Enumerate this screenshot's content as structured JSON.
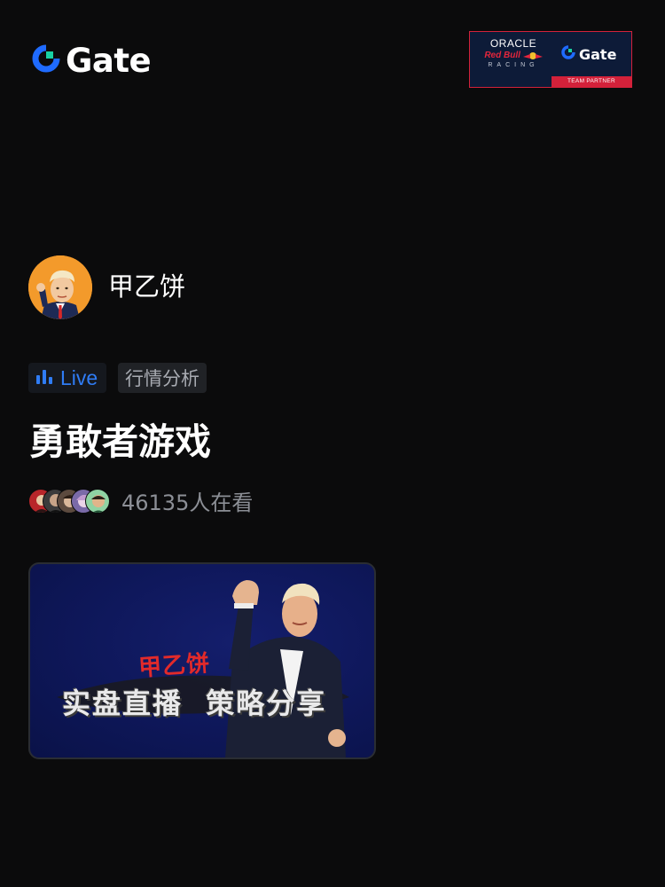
{
  "brand": {
    "wordmark": "Gate",
    "accent_color": "#1f6bff",
    "mint_color": "#18d2a4",
    "logo_icon": "gate-logo-icon"
  },
  "partner_badge": {
    "oracle": "ORACLE",
    "redbull": "Red Bull",
    "racing": "RACING",
    "gate": "Gate",
    "strip": "TEAM PARTNER",
    "bg_color": "#0d1b38",
    "strip_color": "#d3213a"
  },
  "host": {
    "name": "甲乙饼",
    "avatar_icon": "host-avatar-cartoon"
  },
  "tags": {
    "live_label": "Live",
    "live_icon": "bar-chart-icon",
    "live_color": "#2f7cf5",
    "category": "行情分析"
  },
  "stream": {
    "title": "勇敢者游戏",
    "viewer_count": "46135人在看"
  },
  "cover": {
    "name_overlay": "甲乙饼",
    "headline": "实盘直播  策略分享",
    "bg_color": "#0e1759"
  }
}
